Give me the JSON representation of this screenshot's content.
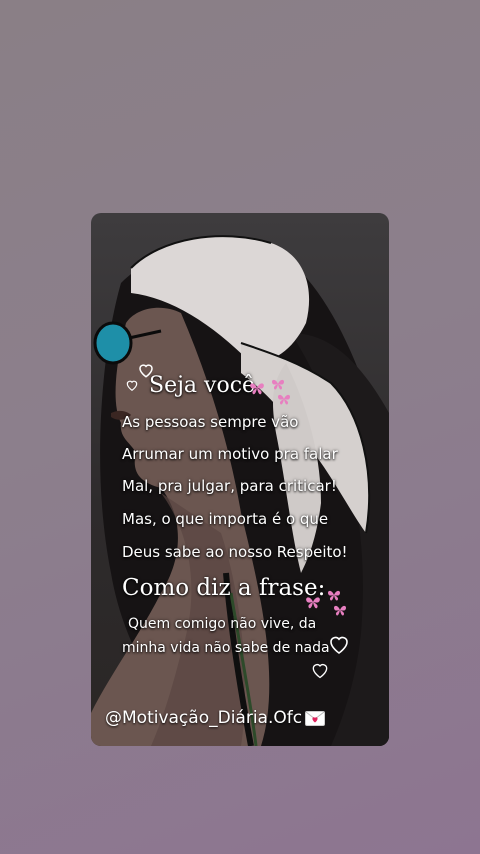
{
  "post": {
    "heading": "Seja você",
    "lines": [
      "As pessoas sempre vão",
      "Arrumar um motivo pra falar",
      "Mal, pra julgar, para criticar!",
      "Mas, o que importa é o que",
      "Deus sabe ao nosso Respeito!"
    ],
    "subheading": "Como diz a frase:",
    "quote_lines": [
      "Quem comigo não vive, da",
      "minha vida não sabe de nada"
    ],
    "watermark": "@Motivação_Diária.Ofc"
  },
  "colors": {
    "background": "#8c7f8a",
    "text": "#ffffff",
    "butterfly": "#e77fc0"
  },
  "icons": [
    "heart-outline-icon",
    "butterfly-icon",
    "love-letter-icon"
  ]
}
